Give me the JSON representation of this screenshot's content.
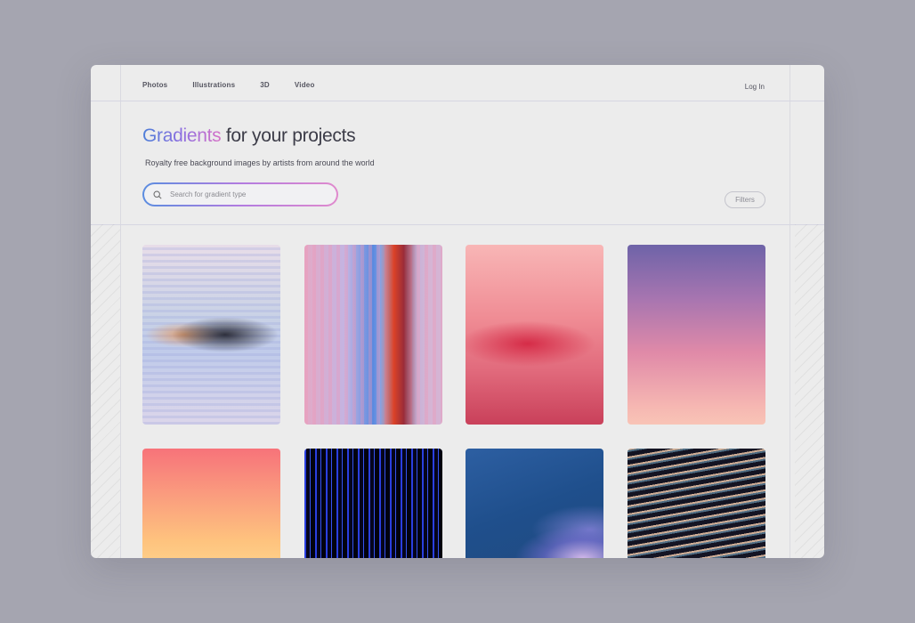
{
  "nav": {
    "items": [
      "Photos",
      "Illustrations",
      "3D",
      "Video"
    ],
    "login": "Log In"
  },
  "hero": {
    "title_highlight": "Gradients",
    "title_rest": " for your projects",
    "subtitle": "Royalty free background images by artists from around the world"
  },
  "search": {
    "icon": "search-icon",
    "placeholder": "Search for gradient type"
  },
  "filters": {
    "label": "Filters"
  },
  "gallery": {
    "cards": [
      {
        "name": "gradient-card-blur-ripple",
        "colors": [
          "#e8dde8",
          "#c0cbea",
          "#e68c46"
        ]
      },
      {
        "name": "gradient-card-vertical-streaks",
        "colors": [
          "#e3a9c6",
          "#5a8ae0",
          "#dc3c1e"
        ]
      },
      {
        "name": "gradient-card-pink-red",
        "colors": [
          "#f8b6b6",
          "#e16a7c",
          "#c9405a"
        ]
      },
      {
        "name": "gradient-card-purple-peach",
        "colors": [
          "#6e63a8",
          "#e08aa8",
          "#f8c4b6"
        ]
      },
      {
        "name": "gradient-card-coral-yellow",
        "colors": [
          "#f7737a",
          "#fa9c7e",
          "#ffd08a"
        ]
      },
      {
        "name": "gradient-card-blue-lines",
        "colors": [
          "#2a3fe0",
          "#05051c"
        ]
      },
      {
        "name": "gradient-card-blue-wave",
        "colors": [
          "#2d5fa2",
          "#dcbef0"
        ]
      },
      {
        "name": "gradient-card-dark-waves",
        "colors": [
          "#0a0a14",
          "#f0c8aa",
          "#78aac8"
        ]
      }
    ]
  }
}
